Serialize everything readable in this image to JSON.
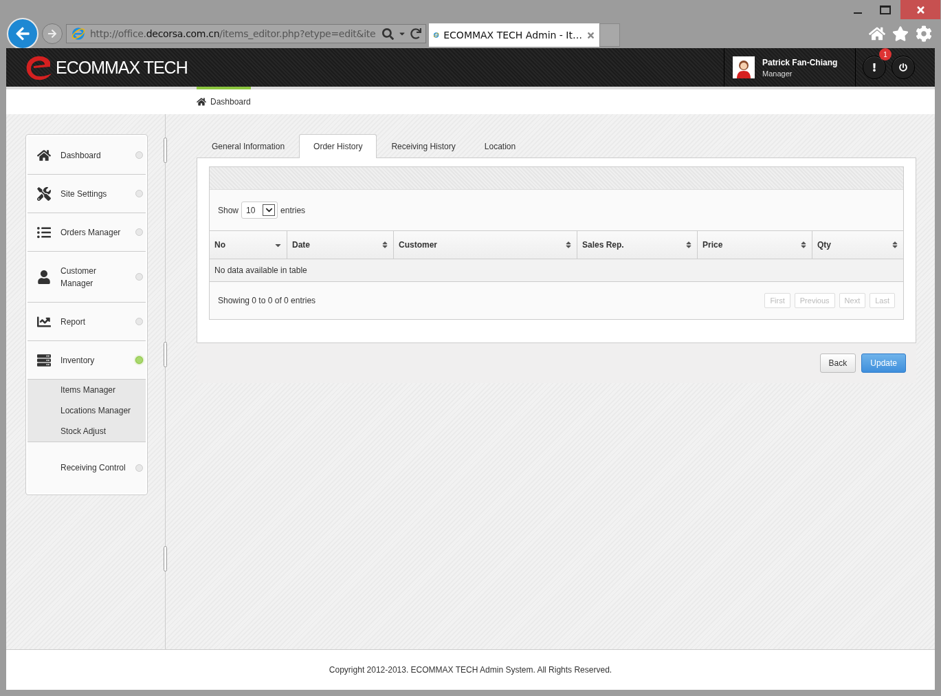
{
  "browser": {
    "address": {
      "prefix": "http://office.",
      "domain": "decorsa.com.cn",
      "path": "/items_editor.php?etype=edit&ite"
    },
    "tabs": [
      {
        "title": "ECOMMAX TECH Admin - It…",
        "selected": true
      }
    ]
  },
  "header": {
    "logo": "ECOMMAX TECH",
    "user": {
      "name": "Patrick Fan-Chiang",
      "role": "Manager"
    },
    "notifications": "1"
  },
  "breadcrumb": {
    "label": "Dashboard"
  },
  "sidebar": {
    "items": [
      {
        "label": "Dashboard",
        "active": false
      },
      {
        "label": "Site Settings",
        "active": false
      },
      {
        "label": "Orders Manager",
        "active": false
      },
      {
        "label": "Customer Manager",
        "active": false
      },
      {
        "label": "Report",
        "active": false
      },
      {
        "label": "Inventory",
        "active": true,
        "children": [
          {
            "label": "Items Manager"
          },
          {
            "label": "Locations Manager"
          },
          {
            "label": "Stock Adjust"
          }
        ]
      },
      {
        "label": "Receiving Control",
        "active": false
      }
    ]
  },
  "tabs": [
    {
      "label": "General Information",
      "selected": false
    },
    {
      "label": "Order History",
      "selected": true
    },
    {
      "label": "Receiving History",
      "selected": false
    },
    {
      "label": "Location",
      "selected": false
    }
  ],
  "table": {
    "length": {
      "before": "Show",
      "value": "10",
      "after": "entries"
    },
    "columns": [
      {
        "label": "No",
        "sorted": true
      },
      {
        "label": "Date",
        "sorted": false
      },
      {
        "label": "Customer",
        "sorted": false
      },
      {
        "label": "Sales Rep.",
        "sorted": false
      },
      {
        "label": "Price",
        "sorted": false
      },
      {
        "label": "Qty",
        "sorted": false
      }
    ],
    "empty": "No data available in table",
    "info": "Showing 0 to 0 of 0 entries",
    "pager": [
      {
        "label": "First",
        "disabled": true
      },
      {
        "label": "Previous",
        "disabled": true
      },
      {
        "label": "Next",
        "disabled": true
      },
      {
        "label": "Last",
        "disabled": true
      }
    ]
  },
  "buttons": [
    {
      "label": "Back",
      "kind": "default"
    },
    {
      "label": "Update",
      "kind": "primary"
    }
  ],
  "footer": "Copyright 2012-2013. ECOMMAX TECH Admin System. All Rights Reserved."
}
